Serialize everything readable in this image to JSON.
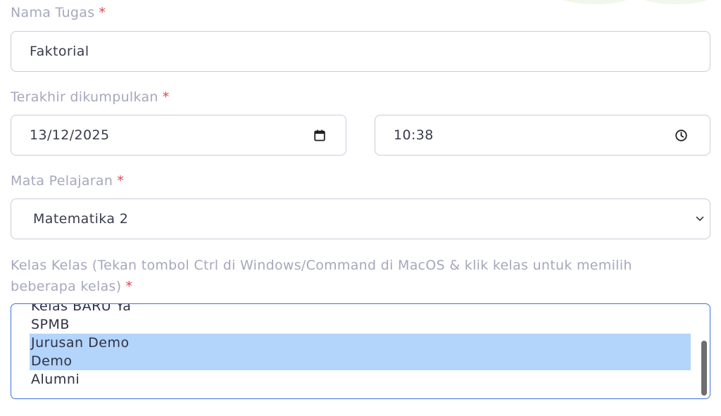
{
  "form": {
    "task_name": {
      "label": "Nama Tugas",
      "required_mark": "*",
      "value": "Faktorial"
    },
    "deadline": {
      "label": "Terakhir dikumpulkan",
      "required_mark": "*",
      "date_value": "13/12/2025",
      "time_value": "10:38"
    },
    "subject": {
      "label": "Mata Pelajaran",
      "required_mark": "*",
      "selected": "Matematika 2"
    },
    "classes": {
      "label_line1": "Kelas Kelas (Tekan tombol Ctrl di Windows/Command di MacOS & klik kelas untuk memilih",
      "label_line2": "beberapa kelas)",
      "required_mark": "*",
      "options": [
        {
          "label": "Kelas BARU Ya",
          "selected": false
        },
        {
          "label": "SPMB",
          "selected": false
        },
        {
          "label": "Jurusan Demo",
          "selected": true
        },
        {
          "label": "Demo",
          "selected": true
        },
        {
          "label": "Alumni",
          "selected": false
        }
      ]
    }
  },
  "icons": {
    "date": "calendar-icon",
    "time": "clock-icon",
    "select": "chevron-down-icon"
  },
  "colors": {
    "label": "#a6a8bd",
    "required": "#e0454d",
    "border": "#c9ccd9",
    "focus_border": "#3d6fe3",
    "selection": "#b3d4fb"
  }
}
